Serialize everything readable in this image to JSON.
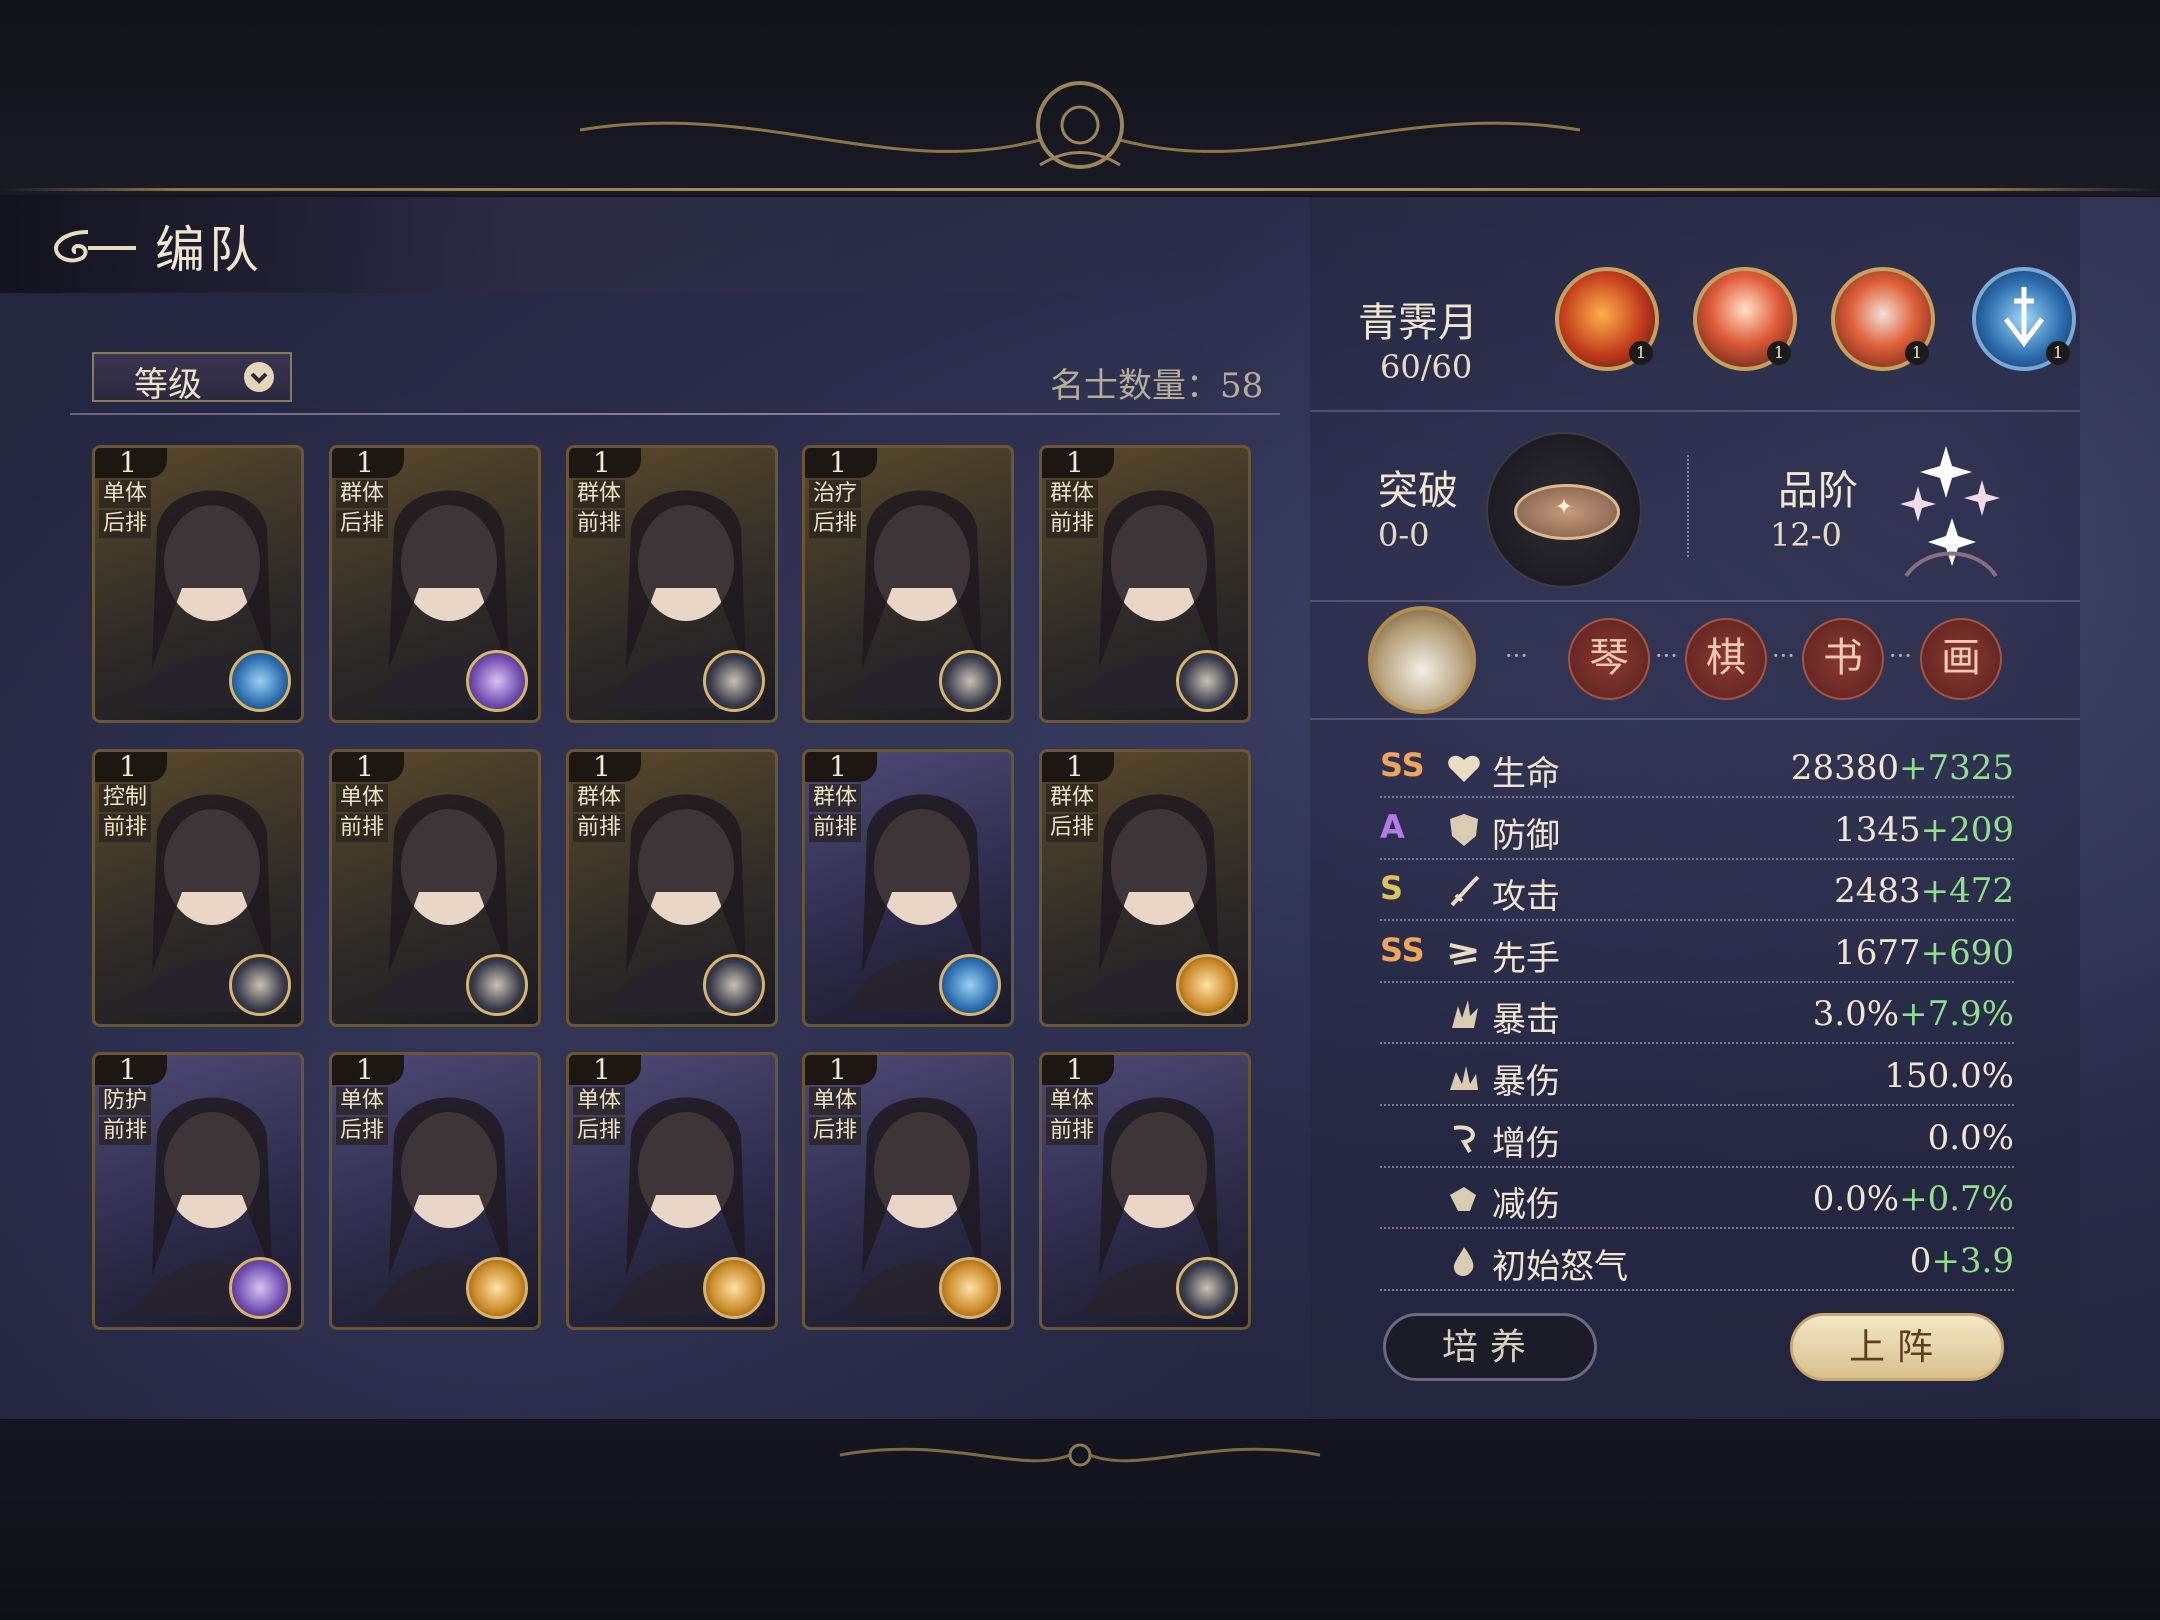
{
  "header": {
    "title": "编队"
  },
  "filter": {
    "sort_label": "等级",
    "count_label": "名士数量：58"
  },
  "cards": [
    {
      "level": "1",
      "tag1": "单体",
      "tag2": "后排",
      "element": "blue"
    },
    {
      "level": "1",
      "tag1": "群体",
      "tag2": "后排",
      "element": "purple"
    },
    {
      "level": "1",
      "tag1": "群体",
      "tag2": "前排",
      "element": "dark"
    },
    {
      "level": "1",
      "tag1": "治疗",
      "tag2": "后排",
      "element": "dark"
    },
    {
      "level": "1",
      "tag1": "群体",
      "tag2": "前排",
      "element": "dark"
    },
    {
      "level": "1",
      "tag1": "控制",
      "tag2": "前排",
      "element": "dark"
    },
    {
      "level": "1",
      "tag1": "单体",
      "tag2": "前排",
      "element": "dark"
    },
    {
      "level": "1",
      "tag1": "群体",
      "tag2": "前排",
      "element": "dark"
    },
    {
      "level": "1",
      "tag1": "群体",
      "tag2": "前排",
      "element": "blue"
    },
    {
      "level": "1",
      "tag1": "群体",
      "tag2": "后排",
      "element": "gold"
    },
    {
      "level": "1",
      "tag1": "防护",
      "tag2": "前排",
      "element": "purple"
    },
    {
      "level": "1",
      "tag1": "单体",
      "tag2": "后排",
      "element": "gold"
    },
    {
      "level": "1",
      "tag1": "单体",
      "tag2": "后排",
      "element": "gold"
    },
    {
      "level": "1",
      "tag1": "单体",
      "tag2": "后排",
      "element": "gold"
    },
    {
      "level": "1",
      "tag1": "单体",
      "tag2": "前排",
      "element": "dark"
    }
  ],
  "hero": {
    "name": "青霁月",
    "level": "60/60",
    "skills": [
      {
        "icon": "flame-slash-icon",
        "level": "1"
      },
      {
        "icon": "fox-spirit-icon",
        "level": "1"
      },
      {
        "icon": "fire-beast-icon",
        "level": "1"
      },
      {
        "icon": "sword-shield-icon",
        "level": "1"
      }
    ],
    "breakthrough": {
      "label": "突破",
      "value": "0-0"
    },
    "rank": {
      "label": "品阶",
      "value": "12-0"
    },
    "arts": [
      "琴",
      "棋",
      "书",
      "画"
    ],
    "ellipsis": "···"
  },
  "stats": [
    {
      "grade": "SS",
      "grade_color": "#f0a55a",
      "icon": "heart-icon",
      "name": "生命",
      "base": "28380",
      "bonus": "+7325"
    },
    {
      "grade": "A",
      "grade_color": "#b57ae8",
      "icon": "shield-icon",
      "name": "防御",
      "base": "1345",
      "bonus": "+209"
    },
    {
      "grade": "S",
      "grade_color": "#e0c25a",
      "icon": "sword-icon",
      "name": "攻击",
      "base": "2483",
      "bonus": "+472"
    },
    {
      "grade": "SS",
      "grade_color": "#f0a55a",
      "icon": "speed-icon",
      "name": "先手",
      "base": "1677",
      "bonus": "+690"
    },
    {
      "grade": "",
      "grade_color": "",
      "icon": "crit-icon",
      "name": "暴击",
      "base": "3.0%",
      "bonus": "+7.9%"
    },
    {
      "grade": "",
      "grade_color": "",
      "icon": "crit-damage-icon",
      "name": "暴伤",
      "base": "150.0%",
      "bonus": ""
    },
    {
      "grade": "",
      "grade_color": "",
      "icon": "damage-up-icon",
      "name": "增伤",
      "base": "0.0%",
      "bonus": ""
    },
    {
      "grade": "",
      "grade_color": "",
      "icon": "damage-reduce-icon",
      "name": "减伤",
      "base": "0.0%",
      "bonus": "+0.7%"
    },
    {
      "grade": "",
      "grade_color": "",
      "icon": "rage-icon",
      "name": "初始怒气",
      "base": "0",
      "bonus": "+3.9"
    }
  ],
  "buttons": {
    "train": "培养",
    "deploy": "上阵"
  }
}
